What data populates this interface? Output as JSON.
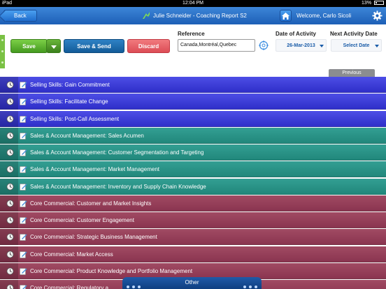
{
  "status_bar": {
    "carrier": "iPad",
    "time": "12:04 PM",
    "battery": "13%"
  },
  "header": {
    "back_label": "Back",
    "title": "Julie Schneider - Coaching Report S2",
    "welcome": "Welcome, Carlo Sicoli"
  },
  "toolbar": {
    "save_label": "Save",
    "save_send_label": "Save & Send",
    "discard_label": "Discard",
    "reference_label": "Reference",
    "reference_value": "Canada,Montréal,Quebec",
    "date_of_activity_label": "Date of Activity",
    "date_of_activity_value": "26-Mar-2013",
    "next_activity_label": "Next Activity Date",
    "next_activity_value": "Select Date",
    "previous_label": "Previous"
  },
  "rows": [
    {
      "label": "Selling Skills: Gain Commitment"
    },
    {
      "label": "Selling Skills: Facilitate Change"
    },
    {
      "label": "Selling Skills: Post-Call Assessment"
    },
    {
      "label": "Sales & Account Management: Sales Acumen"
    },
    {
      "label": "Sales & Account Management: Customer Segmentation and Targeting"
    },
    {
      "label": "Sales & Account Management: Market Management"
    },
    {
      "label": "Sales & Account Management: Inventory and Supply Chain Knowledge"
    },
    {
      "label": "Core Commercial: Customer and Market Insights"
    },
    {
      "label": "Core Commercial: Customer Engagement"
    },
    {
      "label": "Core Commercial: Strategic Business Management"
    },
    {
      "label": "Core Commercial: Market Access"
    },
    {
      "label": "Core Commercial: Product Knowledge and Portfolio Management"
    },
    {
      "label": "Core Commercial: Regulatory a"
    }
  ],
  "other_label": "Other",
  "colors": {
    "selling": "#3a3ad6",
    "sales_account": "#2a9386",
    "core_commercial": "#923d58",
    "header": "#2d73c8"
  }
}
